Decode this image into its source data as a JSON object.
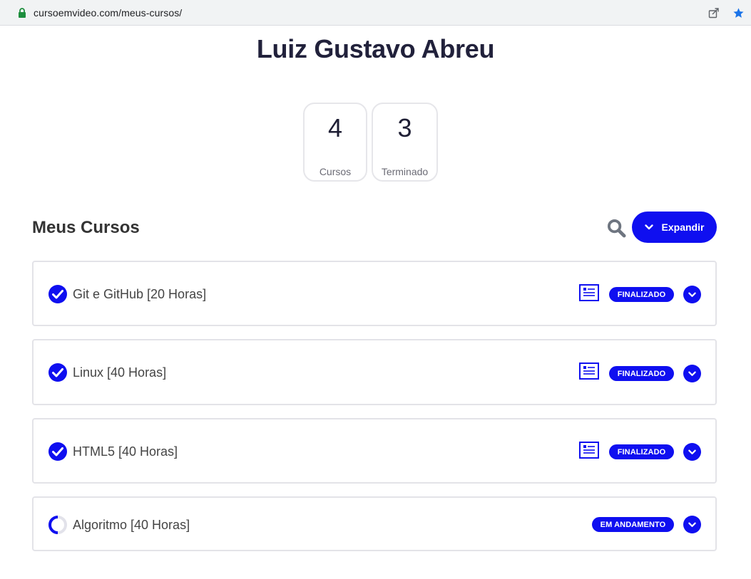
{
  "browser": {
    "url": "cursoemvideo.com/meus-cursos/"
  },
  "profile": {
    "name": "Luiz Gustavo Abreu"
  },
  "stats": [
    {
      "value": "4",
      "label": "Cursos"
    },
    {
      "value": "3",
      "label": "Terminado"
    }
  ],
  "section": {
    "title": "Meus Cursos",
    "expand_label": "Expandir"
  },
  "courses": [
    {
      "title": "Git e GitHub [20 Horas]",
      "status": "FINALIZADO"
    },
    {
      "title": "Linux [40 Horas]",
      "status": "FINALIZADO"
    },
    {
      "title": "HTML5 [40 Horas]",
      "status": "FINALIZADO"
    },
    {
      "title": "Algoritmo [40 Horas]",
      "status": "EM ANDAMENTO"
    }
  ],
  "colors": {
    "accent": "#0f0ff0",
    "heading": "#21213b",
    "border": "#e3e3e8"
  }
}
